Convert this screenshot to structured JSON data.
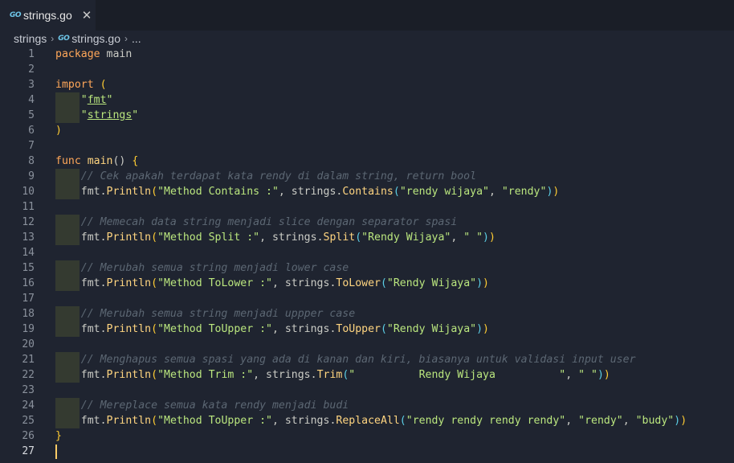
{
  "tab": {
    "icon": "GO",
    "label": "strings.go",
    "close": "✕"
  },
  "breadcrumb": {
    "folder": "strings",
    "sep": "›",
    "icon": "GO",
    "file": "strings.go",
    "more": "..."
  },
  "lines": [
    {
      "n": "1",
      "indent": false,
      "tokens": [
        [
          "k",
          "package"
        ],
        [
          "t",
          " main"
        ]
      ]
    },
    {
      "n": "2",
      "indent": false,
      "tokens": []
    },
    {
      "n": "3",
      "indent": false,
      "tokens": [
        [
          "k",
          "import"
        ],
        [
          "t",
          " "
        ],
        [
          "p",
          "("
        ]
      ]
    },
    {
      "n": "4",
      "indent": true,
      "tokens": [
        [
          "t",
          "    "
        ],
        [
          "s",
          "\""
        ],
        [
          "su",
          "fmt"
        ],
        [
          "s",
          "\""
        ]
      ]
    },
    {
      "n": "5",
      "indent": true,
      "tokens": [
        [
          "t",
          "    "
        ],
        [
          "s",
          "\""
        ],
        [
          "su",
          "strings"
        ],
        [
          "s",
          "\""
        ]
      ]
    },
    {
      "n": "6",
      "indent": false,
      "tokens": [
        [
          "p",
          ")"
        ]
      ]
    },
    {
      "n": "7",
      "indent": false,
      "tokens": []
    },
    {
      "n": "8",
      "indent": false,
      "tokens": [
        [
          "k",
          "func"
        ],
        [
          "t",
          " "
        ],
        [
          "f",
          "main"
        ],
        [
          "t",
          "() "
        ],
        [
          "p",
          "{"
        ]
      ]
    },
    {
      "n": "9",
      "indent": true,
      "tokens": [
        [
          "t",
          "    "
        ],
        [
          "c",
          "// Cek apakah terdapat kata rendy di dalam string, return bool"
        ]
      ]
    },
    {
      "n": "10",
      "indent": true,
      "tokens": [
        [
          "t",
          "    fmt."
        ],
        [
          "f",
          "Println"
        ],
        [
          "p",
          "("
        ],
        [
          "s",
          "\"Method Contains :\""
        ],
        [
          "t",
          ", strings."
        ],
        [
          "f",
          "Contains"
        ],
        [
          "m",
          "("
        ],
        [
          "s",
          "\"rendy wijaya\""
        ],
        [
          "t",
          ", "
        ],
        [
          "s",
          "\"rendy\""
        ],
        [
          "m",
          ")"
        ],
        [
          "p",
          ")"
        ]
      ]
    },
    {
      "n": "11",
      "indent": false,
      "tokens": []
    },
    {
      "n": "12",
      "indent": true,
      "tokens": [
        [
          "t",
          "    "
        ],
        [
          "c",
          "// Memecah data string menjadi slice dengan separator spasi"
        ]
      ]
    },
    {
      "n": "13",
      "indent": true,
      "tokens": [
        [
          "t",
          "    fmt."
        ],
        [
          "f",
          "Println"
        ],
        [
          "p",
          "("
        ],
        [
          "s",
          "\"Method Split :\""
        ],
        [
          "t",
          ", strings."
        ],
        [
          "f",
          "Split"
        ],
        [
          "m",
          "("
        ],
        [
          "s",
          "\"Rendy Wijaya\""
        ],
        [
          "t",
          ", "
        ],
        [
          "s",
          "\" \""
        ],
        [
          "m",
          ")"
        ],
        [
          "p",
          ")"
        ]
      ]
    },
    {
      "n": "14",
      "indent": false,
      "tokens": []
    },
    {
      "n": "15",
      "indent": true,
      "tokens": [
        [
          "t",
          "    "
        ],
        [
          "c",
          "// Merubah semua string menjadi lower case"
        ]
      ]
    },
    {
      "n": "16",
      "indent": true,
      "tokens": [
        [
          "t",
          "    fmt."
        ],
        [
          "f",
          "Println"
        ],
        [
          "p",
          "("
        ],
        [
          "s",
          "\"Method ToLower :\""
        ],
        [
          "t",
          ", strings."
        ],
        [
          "f",
          "ToLower"
        ],
        [
          "m",
          "("
        ],
        [
          "s",
          "\"Rendy Wijaya\""
        ],
        [
          "m",
          ")"
        ],
        [
          "p",
          ")"
        ]
      ]
    },
    {
      "n": "17",
      "indent": false,
      "tokens": []
    },
    {
      "n": "18",
      "indent": true,
      "tokens": [
        [
          "t",
          "    "
        ],
        [
          "c",
          "// Merubah semua string menjadi uppper case"
        ]
      ]
    },
    {
      "n": "19",
      "indent": true,
      "tokens": [
        [
          "t",
          "    fmt."
        ],
        [
          "f",
          "Println"
        ],
        [
          "p",
          "("
        ],
        [
          "s",
          "\"Method ToUpper :\""
        ],
        [
          "t",
          ", strings."
        ],
        [
          "f",
          "ToUpper"
        ],
        [
          "m",
          "("
        ],
        [
          "s",
          "\"Rendy Wijaya\""
        ],
        [
          "m",
          ")"
        ],
        [
          "p",
          ")"
        ]
      ]
    },
    {
      "n": "20",
      "indent": false,
      "tokens": []
    },
    {
      "n": "21",
      "indent": true,
      "tokens": [
        [
          "t",
          "    "
        ],
        [
          "c",
          "// Menghapus semua spasi yang ada di kanan dan kiri, biasanya untuk validasi input user"
        ]
      ]
    },
    {
      "n": "22",
      "indent": true,
      "tokens": [
        [
          "t",
          "    fmt."
        ],
        [
          "f",
          "Println"
        ],
        [
          "p",
          "("
        ],
        [
          "s",
          "\"Method Trim :\""
        ],
        [
          "t",
          ", strings."
        ],
        [
          "f",
          "Trim"
        ],
        [
          "m",
          "("
        ],
        [
          "s",
          "\"          Rendy Wijaya          \""
        ],
        [
          "t",
          ", "
        ],
        [
          "s",
          "\" \""
        ],
        [
          "m",
          ")"
        ],
        [
          "p",
          ")"
        ]
      ]
    },
    {
      "n": "23",
      "indent": false,
      "tokens": []
    },
    {
      "n": "24",
      "indent": true,
      "tokens": [
        [
          "t",
          "    "
        ],
        [
          "c",
          "// Mereplace semua kata rendy menjadi budi"
        ]
      ]
    },
    {
      "n": "25",
      "indent": true,
      "tokens": [
        [
          "t",
          "    fmt."
        ],
        [
          "f",
          "Println"
        ],
        [
          "p",
          "("
        ],
        [
          "s",
          "\"Method ToUpper :\""
        ],
        [
          "t",
          ", strings."
        ],
        [
          "f",
          "ReplaceAll"
        ],
        [
          "m",
          "("
        ],
        [
          "s",
          "\"rendy rendy rendy rendy\""
        ],
        [
          "t",
          ", "
        ],
        [
          "s",
          "\"rendy\""
        ],
        [
          "t",
          ", "
        ],
        [
          "s",
          "\"budy\""
        ],
        [
          "m",
          ")"
        ],
        [
          "p",
          ")"
        ]
      ]
    },
    {
      "n": "26",
      "indent": false,
      "tokens": [
        [
          "p",
          "}"
        ]
      ]
    },
    {
      "n": "27",
      "indent": false,
      "current": true,
      "tokens": []
    }
  ]
}
